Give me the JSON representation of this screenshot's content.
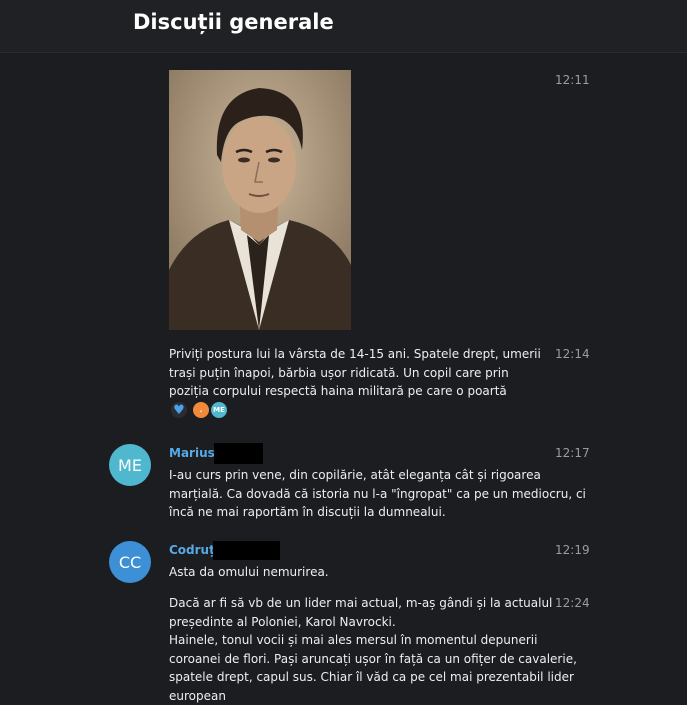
{
  "header": {
    "title": "Discuții generale"
  },
  "messages": [
    {
      "time": "12:11"
    },
    {
      "time": "12:14",
      "text": "Priviți postura lui la vârsta de 14-15 ani. Spatele drept, umerii trași puțin înapoi, bărbia ușor ridicată. Un copil care prin poziția corpului respectă haina militară pe care o poartă",
      "reactions": [
        {
          "icon": "heart-icon",
          "color": "#4aa3ea"
        },
        {
          "label": ".",
          "color": "#f08a3a"
        },
        {
          "label": "ME",
          "color": "#4fb8cf"
        }
      ]
    },
    {
      "avatar": "ME",
      "avatar_color": "#4fb8cf",
      "sender": "Marius",
      "time": "12:17",
      "text": "I-au curs prin vene, din copilărie, atât eleganța cât și rigoarea marțială. Ca dovadă că istoria nu l-a \"îngropat\" ca pe un mediocru, ci încă ne mai raportăm în discuții la dumnealui."
    },
    {
      "avatar": "CC",
      "avatar_color": "#3d8fd6",
      "sender": "Codruț",
      "time": "12:19",
      "text": "Asta da omului nemurirea."
    },
    {
      "time": "12:24",
      "text": "Dacă ar fi să vb de un lider mai actual, m-aș gândi și la actualul președinte al Poloniei, Karol Navrocki.\nHainele, tonul vocii și mai ales mersul în momentul depunerii coroanei de flori. Pași aruncați ușor în față ca un ofițer de cavalerie, spatele drept, capul sus. Chiar îl văd ca pe cel mai prezentabil lider european"
    }
  ]
}
